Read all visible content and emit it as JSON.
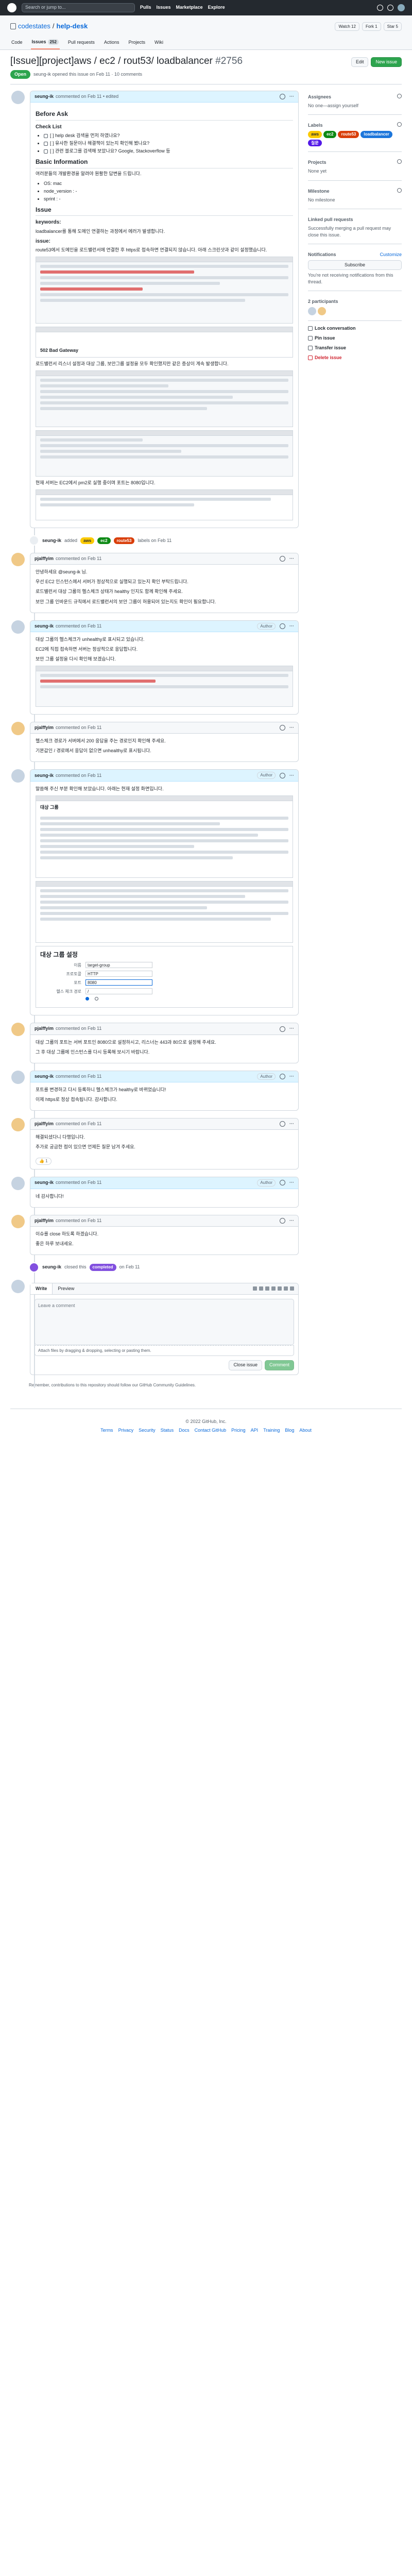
{
  "topbar": {
    "search_placeholder": "Search or jump to...",
    "nav": [
      "Pulls",
      "Issues",
      "Marketplace",
      "Explore"
    ]
  },
  "repo": {
    "owner": "codestates",
    "name": "help-desk",
    "actions": [
      "Watch",
      "Fork",
      "Star"
    ],
    "counts": [
      "12",
      "1",
      "5"
    ]
  },
  "tabs": [
    {
      "label": "Code"
    },
    {
      "label": "Issues",
      "count": "252"
    },
    {
      "label": "Pull requests"
    },
    {
      "label": "Actions"
    },
    {
      "label": "Projects"
    },
    {
      "label": "Wiki"
    }
  ],
  "issue": {
    "title": "[Issue][project]aws / ec2 / rout53/ loadbalancer",
    "number": "#2756",
    "state": "Open",
    "meta": "seung-ik opened this issue on Feb 11 · 10 comments",
    "edit": "Edit",
    "new_issue": "New issue"
  },
  "first_comment": {
    "author": "seung-ik",
    "time": "commented on Feb 11 • edited",
    "before_ask": "Before Ask",
    "check_list": "Check List",
    "checks": [
      "[ ] help desk 검색을 먼저 하였나요?",
      "[ ] 유사한 질문이나 해결책이 있는지 확인해 봤나요?",
      "[ ] 관련 블로그를 검색해 보았나요? Google, Stackoverflow 등"
    ],
    "basic_info": "Basic Information",
    "basic_desc": "여러분들의 개발환경을 알려야 원활한 답변을 드립니다.",
    "env": [
      "OS: mac",
      "node_version : -",
      "sprint : -"
    ],
    "issue_heading": "Issue",
    "keywords_label": "keywords:",
    "keywords_text": "loadbalancer를 통해 도메인 연결하는 과정에서 에러가 발생합니다.",
    "issue_label": "issue:",
    "issue_text": "route53에서 도메인을 로드밸런서에 연결한 후 https로 접속하면 연결되지 않습니다. 아래 스크린샷과 같이 설정했습니다.",
    "caption1": "502 Bad Gateway",
    "issue_text2": "로드밸런서 리스너 설정과 대상 그룹, 보안그룹 설정을 모두 확인했지만 같은 증상이 계속 발생합니다.",
    "issue_text3": "현재 서버는 EC2에서 pm2로 실행 중이며 포트는 8080입니다."
  },
  "events": [
    {
      "author": "seung-ik",
      "text": "added",
      "labels": [
        "aws",
        "ec2",
        "route53"
      ],
      "suffix": "labels on Feb 11"
    }
  ],
  "comments": [
    {
      "author": "pjalffyim",
      "time": "commented on Feb 11",
      "label": "",
      "body": [
        "안녕하세요 @seung-ik 님.",
        "우선 EC2 인스턴스에서 서버가 정상적으로 실행되고 있는지 확인 부탁드립니다.",
        "로드밸런서 대상 그룹의 헬스체크 상태가 healthy 인지도 함께 확인해 주세요.",
        "보안 그룹 인바운드 규칙에서 로드밸런서의 보안 그룹이 허용되어 있는지도 확인이 필요합니다."
      ]
    },
    {
      "author": "seung-ik",
      "time": "commented on Feb 11",
      "label": "Author",
      "body": [
        "대상 그룹의 헬스체크가 unhealthy로 표시되고 있습니다.",
        "EC2에 직접 접속하면 서버는 정상적으로 응답합니다.",
        "보안 그룹 설정을 다시 확인해 보겠습니다."
      ]
    },
    {
      "author": "pjalffyim",
      "time": "commented on Feb 11",
      "label": "",
      "body": [
        "헬스체크 경로가 서버에서 200 응답을 주는 경로인지 확인해 주세요.",
        "기본값인 / 경로에서 응답이 없으면 unhealthy로 표시됩니다."
      ]
    },
    {
      "author": "seung-ik",
      "time": "commented on Feb 11",
      "label": "Author",
      "body": [
        "말씀해 주신 부분 확인해 보았습니다. 아래는 현재 설정 화면입니다."
      ],
      "shot_title": "대상 그룹",
      "form_title": "대상 그룹 설정",
      "form_fields": [
        {
          "label": "이름",
          "value": "target-group"
        },
        {
          "label": "프로토콜",
          "value": "HTTP"
        },
        {
          "label": "포트",
          "value": "8080"
        },
        {
          "label": "헬스 체크 경로",
          "value": "/"
        }
      ]
    },
    {
      "author": "pjalffyim",
      "time": "commented on Feb 11",
      "label": "",
      "body": [
        "대상 그룹의 포트는 서버 포트인 8080으로 설정하시고, 리스너는 443과 80으로 설정해 주세요.",
        "그 후 대상 그룹에 인스턴스를 다시 등록해 보시기 바랍니다."
      ]
    },
    {
      "author": "seung-ik",
      "time": "commented on Feb 11",
      "label": "Author",
      "body": [
        "포트를 변경하고 다시 등록하니 헬스체크가 healthy로 바뀌었습니다!",
        "이제 https로 정상 접속됩니다. 감사합니다."
      ]
    },
    {
      "author": "pjalffyim",
      "time": "commented on Feb 11",
      "label": "",
      "body": [
        "해결되셨다니 다행입니다.",
        "추가로 궁금한 점이 있으면 언제든 질문 남겨 주세요."
      ]
    },
    {
      "author": "seung-ik",
      "time": "commented on Feb 11",
      "label": "Author",
      "body": [
        "네 감사합니다!"
      ]
    },
    {
      "author": "pjalffyim",
      "time": "commented on Feb 11",
      "label": "",
      "body": [
        "이슈를 close 하도록 하겠습니다.",
        "좋은 하루 보내세요."
      ]
    }
  ],
  "close_event": {
    "author": "seung-ik",
    "text": "closed this",
    "label": "completed",
    "suffix": "on Feb 11"
  },
  "new_comment": {
    "write": "Write",
    "preview": "Preview",
    "placeholder": "Leave a comment",
    "attach": "Attach files by dragging & dropping, selecting or pasting them.",
    "close": "Close issue",
    "submit": "Comment",
    "note": "Remember, contributions to this repository should follow our GitHub Community Guidelines."
  },
  "sidebar": {
    "assignees": {
      "title": "Assignees",
      "text": "No one—assign yourself"
    },
    "labels": {
      "title": "Labels",
      "items": [
        {
          "name": "aws",
          "color": "#fbca04"
        },
        {
          "name": "ec2",
          "color": "#0e8a16"
        },
        {
          "name": "route53",
          "color": "#d93f0b"
        },
        {
          "name": "loadbalancer",
          "color": "#1d76db"
        },
        {
          "name": "질문",
          "color": "#5319e7"
        }
      ]
    },
    "projects": {
      "title": "Projects",
      "text": "None yet"
    },
    "milestone": {
      "title": "Milestone",
      "text": "No milestone"
    },
    "linked": {
      "title": "Linked pull requests",
      "text": "Successfully merging a pull request may close this issue."
    },
    "notifications": {
      "title": "Notifications",
      "customize": "Customize",
      "button": "Subscribe",
      "text": "You're not receiving notifications from this thread."
    },
    "participants": {
      "title": "2 participants"
    },
    "actions": [
      "Lock conversation",
      "Pin issue",
      "Transfer issue",
      "Delete issue"
    ]
  },
  "footer": {
    "copyright": "© 2022 GitHub, Inc.",
    "links": [
      "Terms",
      "Privacy",
      "Security",
      "Status",
      "Docs",
      "Contact GitHub",
      "Pricing",
      "API",
      "Training",
      "Blog",
      "About"
    ]
  }
}
